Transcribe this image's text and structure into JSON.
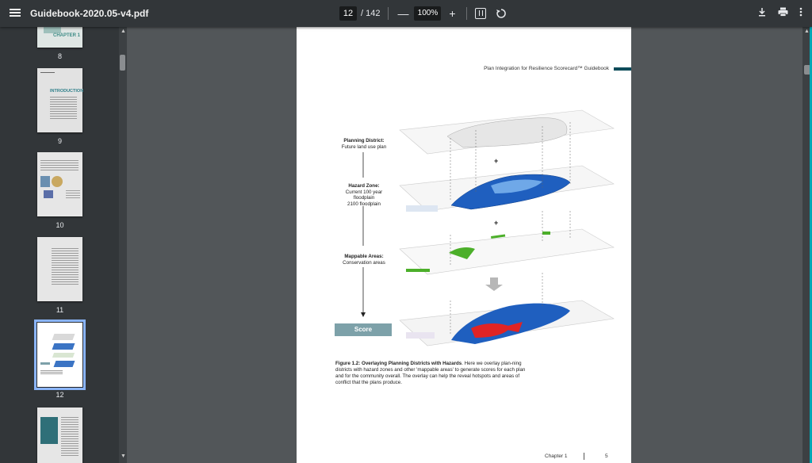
{
  "toolbar": {
    "file_name": "Guidebook-2020.05-v4.pdf",
    "current_page": "12",
    "total_pages": "/ 142",
    "zoom": "100%",
    "zoom_out": "—",
    "zoom_in": "+"
  },
  "sidebar": {
    "thumbnails": [
      {
        "num": "8",
        "caption": "CHAPTER 1"
      },
      {
        "num": "9",
        "caption": "INTRODUCTION"
      },
      {
        "num": "10"
      },
      {
        "num": "11"
      },
      {
        "num": "12",
        "selected": true
      },
      {
        "num": ""
      }
    ]
  },
  "page": {
    "running_head": "Plan Integration for Resilience Scorecard™ Guidebook",
    "layers": {
      "planning_title": "Planning District:",
      "planning_sub": "Future land use plan",
      "hazard_title": "Hazard Zone:",
      "hazard_sub1": "Current 100 year",
      "hazard_sub2": "floodplain",
      "hazard_sub3": "2100 floodplain",
      "mappable_title": "Mappable Areas:",
      "mappable_sub": "Conservation areas",
      "score": "Score"
    },
    "caption_bold": "Figure 1.2: Overlaying Planning Districts with Hazards",
    "caption_text": ". Here we overlay plan-ning districts with hazard zones and other 'mappable areas' to generate scores for each plan and for the community overall. The overlay can help the reveal hotspots and areas of conflict that the plans produce.",
    "footer_chapter": "Chapter 1",
    "footer_page": "5"
  },
  "colors": {
    "toolbar": "#323639",
    "viewer_bg": "#525659",
    "accent_selection": "#8ab4f8",
    "score_box": "#7da1a9",
    "flood_blue": "#1f5fbf",
    "conservation_green": "#4caf2a",
    "conflict_red": "#e02424"
  }
}
